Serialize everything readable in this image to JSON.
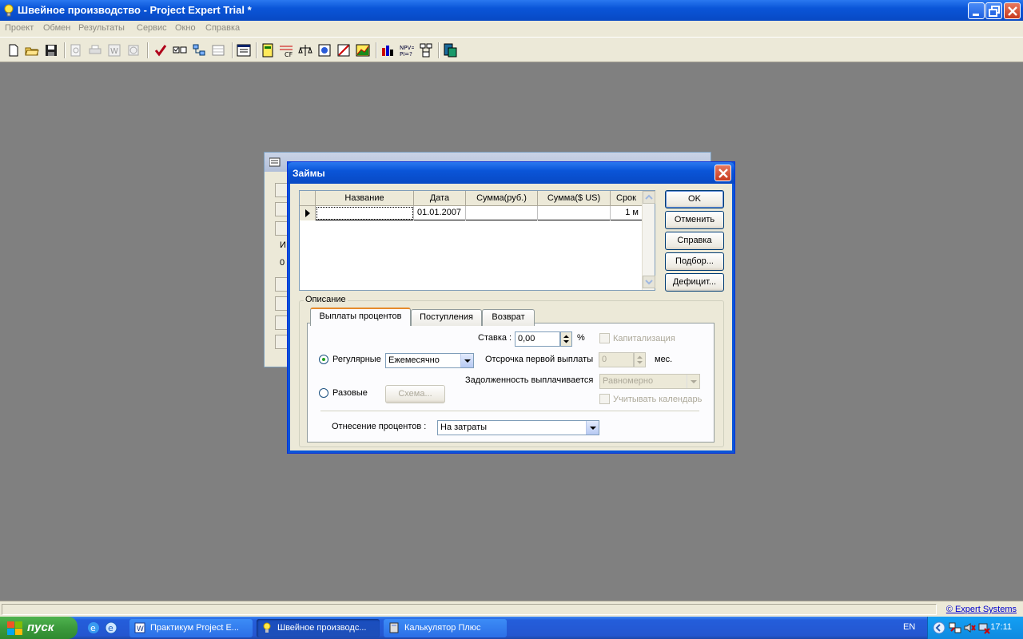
{
  "window": {
    "title": "Швейное производство - Project Expert Trial *"
  },
  "menu": [
    "Проект",
    "Обмен",
    "Результаты",
    "Сервис",
    "Окно",
    "Справка"
  ],
  "background_window": {
    "letters": [
      "И",
      "0"
    ]
  },
  "dialog": {
    "title": "Займы",
    "grid": {
      "columns": [
        "Название",
        "Дата",
        "Сумма(руб.)",
        "Сумма($ US)",
        "Срок"
      ],
      "rows": [
        {
          "name": "",
          "date": "01.01.2007",
          "sum_rub": "",
          "sum_usd": "",
          "term": "1 м"
        }
      ]
    },
    "buttons": {
      "ok": "OK",
      "cancel": "Отменить",
      "help": "Справка",
      "select": "Подбор...",
      "deficit": "Дефицит..."
    },
    "description_label": "Описание",
    "tabs": [
      "Выплаты процентов",
      "Поступления",
      "Возврат"
    ],
    "interest": {
      "rate_label": "Ставка :",
      "rate_value": "0,00",
      "percent_sign": "%",
      "capitalization_label": "Капитализация",
      "regular_label": "Регулярные",
      "regular_option": "Ежемесячно",
      "delay_label": "Отсрочка первой выплаты",
      "delay_value": "0",
      "delay_unit": "мес.",
      "debt_label": "Задолженность выплачивается",
      "debt_option": "Равномерно",
      "one_time_label": "Разовые",
      "scheme_button": "Схема...",
      "calendar_label": "Учитывать календарь",
      "attribution_label": "Отнесение процентов :",
      "attribution_option": "На затраты"
    }
  },
  "statusbar": {
    "link": "© Expert Systems"
  },
  "taskbar": {
    "start": "пуск",
    "tasks": [
      "Практикум Project E...",
      "Швейное производс...",
      "Калькулятор Плюс"
    ],
    "lang": "EN",
    "time": "17:11"
  },
  "colors": {
    "desktop": "#808080",
    "titlebar": "#0a55d8",
    "close": "#c73a1e",
    "face": "#ece9d8"
  }
}
